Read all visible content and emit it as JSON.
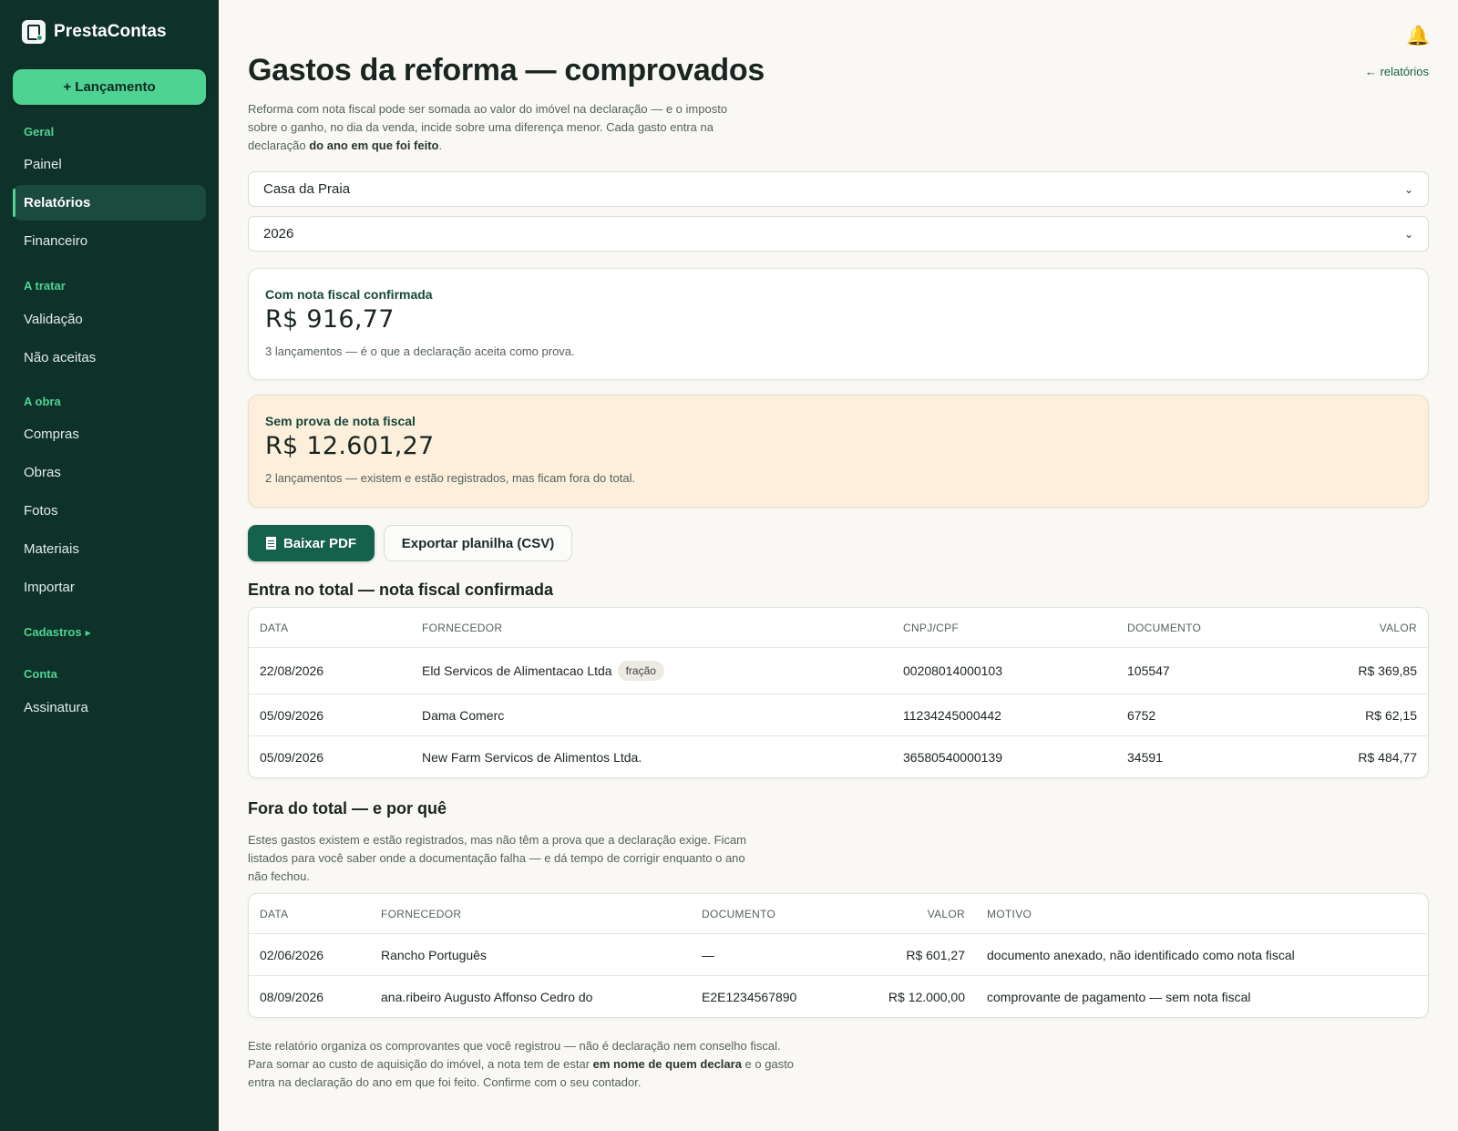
{
  "brand": {
    "name": "PrestaContas"
  },
  "sidebar": {
    "new_button": "+ Lançamento",
    "groups": [
      {
        "label": "Geral",
        "items": [
          "Painel",
          "Relatórios",
          "Financeiro"
        ]
      },
      {
        "label": "A tratar",
        "items": [
          "Validação",
          "Não aceitas"
        ]
      },
      {
        "label": "A obra",
        "items": [
          "Compras",
          "Obras",
          "Fotos",
          "Materiais",
          "Importar"
        ]
      },
      {
        "label": "Cadastros",
        "items": []
      },
      {
        "label": "Conta",
        "items": [
          "Assinatura"
        ]
      }
    ],
    "active_item": "Relatórios"
  },
  "header": {
    "title": "Gastos da reforma — comprovados",
    "back_link": "← relatórios",
    "intro_plain": "Reforma com nota fiscal pode ser somada ao valor do imóvel na declaração — e o imposto sobre o ganho, no dia da venda, incide sobre uma diferença menor. Cada gasto entra na declaração ",
    "intro_bold": "do ano em que foi feito",
    "intro_end": "."
  },
  "filters": {
    "property": "Casa da Praia",
    "year": "2026"
  },
  "summary": {
    "confirmed": {
      "label": "Com nota fiscal confirmada",
      "amount": "R$ 916,77",
      "note": "3 lançamentos — é o que a declaração aceita como prova."
    },
    "unproven": {
      "label": "Sem prova de nota fiscal",
      "amount": "R$ 12.601,27",
      "note": "2 lançamentos — existem e estão registrados, mas ficam fora do total."
    }
  },
  "actions": {
    "pdf": "Baixar PDF",
    "csv": "Exportar planilha (CSV)"
  },
  "included": {
    "title": "Entra no total — nota fiscal confirmada",
    "headers": [
      "DATA",
      "FORNECEDOR",
      "CNPJ/CPF",
      "DOCUMENTO",
      "VALOR"
    ],
    "rows": [
      {
        "data": "22/08/2026",
        "fornecedor": "Eld Servicos de Alimentacao Ltda",
        "tag": "fração",
        "cnpj": "00208014000103",
        "documento": "105547",
        "valor": "R$ 369,85"
      },
      {
        "data": "05/09/2026",
        "fornecedor": "Dama Comerc",
        "tag": "",
        "cnpj": "11234245000442",
        "documento": "6752",
        "valor": "R$ 62,15"
      },
      {
        "data": "05/09/2026",
        "fornecedor": "New Farm Servicos de Alimentos Ltda.",
        "tag": "",
        "cnpj": "36580540000139",
        "documento": "34591",
        "valor": "R$ 484,77"
      }
    ]
  },
  "excluded": {
    "title": "Fora do total — e por quê",
    "description": "Estes gastos existem e estão registrados, mas não têm a prova que a declaração exige. Ficam listados para você saber onde a documentação falha — e dá tempo de corrigir enquanto o ano não fechou.",
    "headers": [
      "DATA",
      "FORNECEDOR",
      "DOCUMENTO",
      "VALOR",
      "MOTIVO"
    ],
    "rows": [
      {
        "data": "02/06/2026",
        "fornecedor": "Rancho Português",
        "documento": "—",
        "valor": "R$ 601,27",
        "motivo": "documento anexado, não identificado como nota fiscal"
      },
      {
        "data": "08/09/2026",
        "fornecedor": "ana.ribeiro Augusto Affonso Cedro do",
        "documento": "E2E1234567890",
        "valor": "R$ 12.000,00",
        "motivo": "comprovante de pagamento — sem nota fiscal"
      }
    ]
  },
  "footer": {
    "text_start": "Este relatório organiza os comprovantes que você registrou — não é declaração nem conselho fiscal. Para somar ao custo de aquisição do imóvel, a nota tem de estar ",
    "text_bold": "em nome de quem declara",
    "text_end": " e o gasto entra na declaração do ano em que foi feito. Confirme com o seu contador."
  },
  "icons": {
    "bell": "bell-icon",
    "pdf": "document-icon",
    "select": "chevron-down-icon"
  },
  "colors": {
    "sidebar": "#0e3129",
    "accent": "#4fd393",
    "primary": "#16614c",
    "warning_bg": "#fcefdc"
  }
}
